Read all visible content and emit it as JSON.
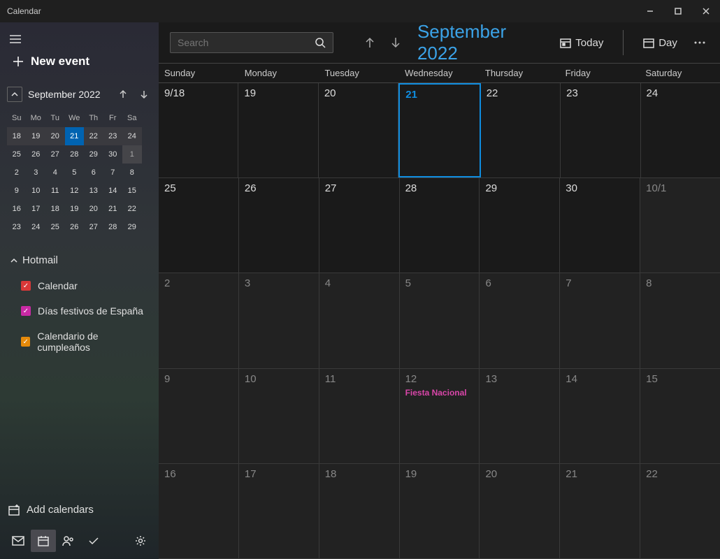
{
  "window": {
    "title": "Calendar"
  },
  "sidebar": {
    "new_event_label": "New event",
    "mini_cal": {
      "title": "September 2022",
      "day_headers": [
        "Su",
        "Mo",
        "Tu",
        "We",
        "Th",
        "Fr",
        "Sa"
      ],
      "rows": [
        [
          {
            "d": "18",
            "cw": true
          },
          {
            "d": "19",
            "cw": true
          },
          {
            "d": "20",
            "cw": true
          },
          {
            "d": "21",
            "cw": true,
            "today": true
          },
          {
            "d": "22",
            "cw": true
          },
          {
            "d": "23",
            "cw": true
          },
          {
            "d": "24",
            "cw": true
          }
        ],
        [
          {
            "d": "25"
          },
          {
            "d": "26"
          },
          {
            "d": "27"
          },
          {
            "d": "28"
          },
          {
            "d": "29"
          },
          {
            "d": "30"
          },
          {
            "d": "1",
            "dim": true
          }
        ],
        [
          {
            "d": "2"
          },
          {
            "d": "3"
          },
          {
            "d": "4"
          },
          {
            "d": "5"
          },
          {
            "d": "6"
          },
          {
            "d": "7"
          },
          {
            "d": "8"
          }
        ],
        [
          {
            "d": "9"
          },
          {
            "d": "10"
          },
          {
            "d": "11"
          },
          {
            "d": "12"
          },
          {
            "d": "13"
          },
          {
            "d": "14"
          },
          {
            "d": "15"
          }
        ],
        [
          {
            "d": "16"
          },
          {
            "d": "17"
          },
          {
            "d": "18"
          },
          {
            "d": "19"
          },
          {
            "d": "20"
          },
          {
            "d": "21"
          },
          {
            "d": "22"
          }
        ],
        [
          {
            "d": "23"
          },
          {
            "d": "24"
          },
          {
            "d": "25"
          },
          {
            "d": "26"
          },
          {
            "d": "27"
          },
          {
            "d": "28"
          },
          {
            "d": "29"
          }
        ]
      ]
    },
    "account_label": "Hotmail",
    "calendars": [
      {
        "label": "Calendar",
        "color": "#d93838"
      },
      {
        "label": "Días festivos de España",
        "color": "#c92aa5"
      },
      {
        "label": "Calendario de cumpleaños",
        "color": "#e68a0a"
      }
    ],
    "add_calendars_label": "Add calendars"
  },
  "topbar": {
    "search_placeholder": "Search",
    "month_title": "September 2022",
    "today_label": "Today",
    "view_label": "Day"
  },
  "day_headers": [
    "Sunday",
    "Monday",
    "Tuesday",
    "Wednesday",
    "Thursday",
    "Friday",
    "Saturday"
  ],
  "weeks": [
    [
      {
        "n": "9/18"
      },
      {
        "n": "19"
      },
      {
        "n": "20"
      },
      {
        "n": "21",
        "today": true
      },
      {
        "n": "22"
      },
      {
        "n": "23"
      },
      {
        "n": "24"
      }
    ],
    [
      {
        "n": "25"
      },
      {
        "n": "26"
      },
      {
        "n": "27"
      },
      {
        "n": "28"
      },
      {
        "n": "29"
      },
      {
        "n": "30"
      },
      {
        "n": "10/1",
        "out": true
      }
    ],
    [
      {
        "n": "2",
        "out": true
      },
      {
        "n": "3",
        "out": true
      },
      {
        "n": "4",
        "out": true
      },
      {
        "n": "5",
        "out": true
      },
      {
        "n": "6",
        "out": true
      },
      {
        "n": "7",
        "out": true
      },
      {
        "n": "8",
        "out": true
      }
    ],
    [
      {
        "n": "9",
        "out": true
      },
      {
        "n": "10",
        "out": true
      },
      {
        "n": "11",
        "out": true
      },
      {
        "n": "12",
        "out": true,
        "event": "Fiesta Nacional"
      },
      {
        "n": "13",
        "out": true
      },
      {
        "n": "14",
        "out": true
      },
      {
        "n": "15",
        "out": true
      }
    ],
    [
      {
        "n": "16",
        "out": true
      },
      {
        "n": "17",
        "out": true
      },
      {
        "n": "18",
        "out": true
      },
      {
        "n": "19",
        "out": true
      },
      {
        "n": "20",
        "out": true
      },
      {
        "n": "21",
        "out": true
      },
      {
        "n": "22",
        "out": true
      }
    ]
  ]
}
